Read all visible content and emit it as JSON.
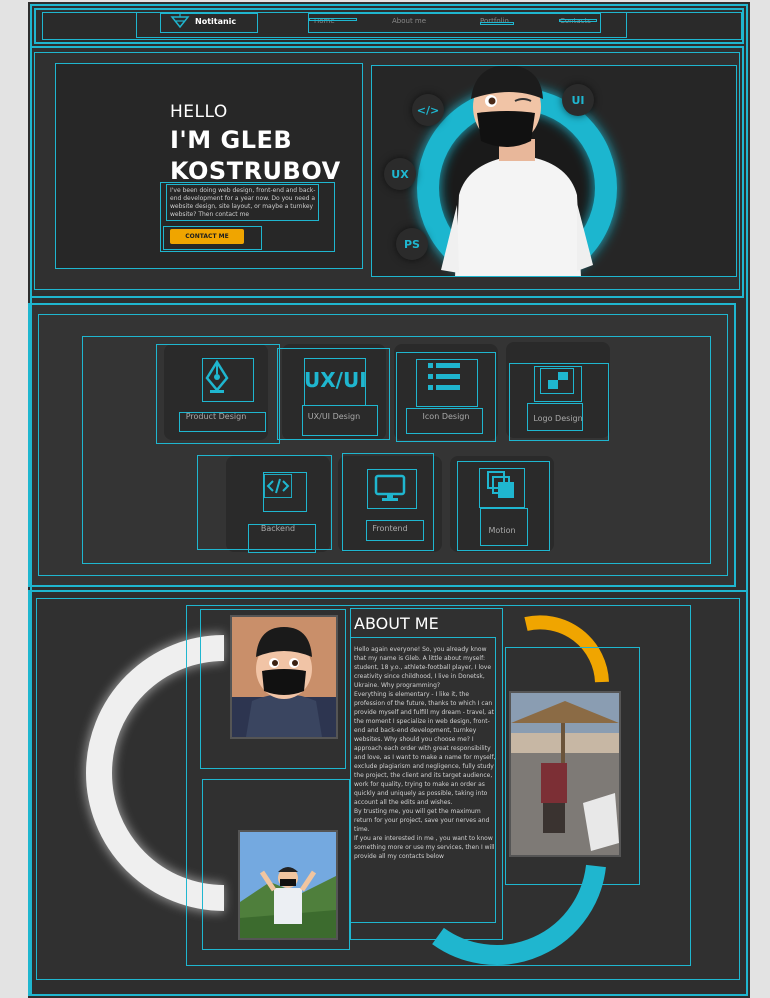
{
  "nav": {
    "logo": "Notitanic",
    "links": [
      "Home",
      "About me",
      "Portfolio",
      "Contacts"
    ]
  },
  "hero": {
    "greeting": "HELLO",
    "name_line1": "I'M GLEB",
    "name_line2": "KOSTRUBOV",
    "intro": "I've been doing web design, front-end and back-end development for a year now. Do you need a website design, site layout, or maybe a turnkey website? Then contact me",
    "cta_label": "CONTACT ME",
    "badges": [
      "</>",
      "UI",
      "UX",
      "PS"
    ]
  },
  "services": [
    {
      "label": "Product Design",
      "icon": "pen-nib-icon"
    },
    {
      "label": "UX/UI Design",
      "icon": "ux-ui-text-icon"
    },
    {
      "label": "Icon Design",
      "icon": "list-icon"
    },
    {
      "label": "Logo Design",
      "icon": "logo-squares-icon"
    },
    {
      "label": "Backend",
      "icon": "code-icon"
    },
    {
      "label": "Frontend",
      "icon": "monitor-icon"
    },
    {
      "label": "Motion",
      "icon": "layers-icon"
    }
  ],
  "services_icon_text": "UX/UI",
  "about": {
    "title": "ABOUT ME",
    "paragraphs": [
      "Hello again everyone! So, you already know that my name is Gleb. A little about myself: student, 18 y.o., athlete-football player, I love creativity since childhood, I live in Donetsk, Ukraine. Why programming?",
      "Everything is elementary - I like it, the profession of the future, thanks to which I can provide myself and fulfill my dream - travel, at the moment I specialize in web design, front-end and back-end development, turnkey websites. Why should you choose me? I approach each order with great responsibility and love, as I want to make a name for myself, exclude plagiarism and negligence, fully study the project, the client and its target audience, work for quality, trying to make an order as quickly and uniquely as possible, taking into account all the edits and wishes.",
      "By trusting me, you will get the maximum return for your project, save your nerves and time.",
      "If you are interested in me , you want to know something more or use my services, then I will provide all my contacts below"
    ]
  },
  "colors": {
    "accent": "#1fb6cf",
    "cta": "#f0a500",
    "background": "#2e2e2e"
  }
}
